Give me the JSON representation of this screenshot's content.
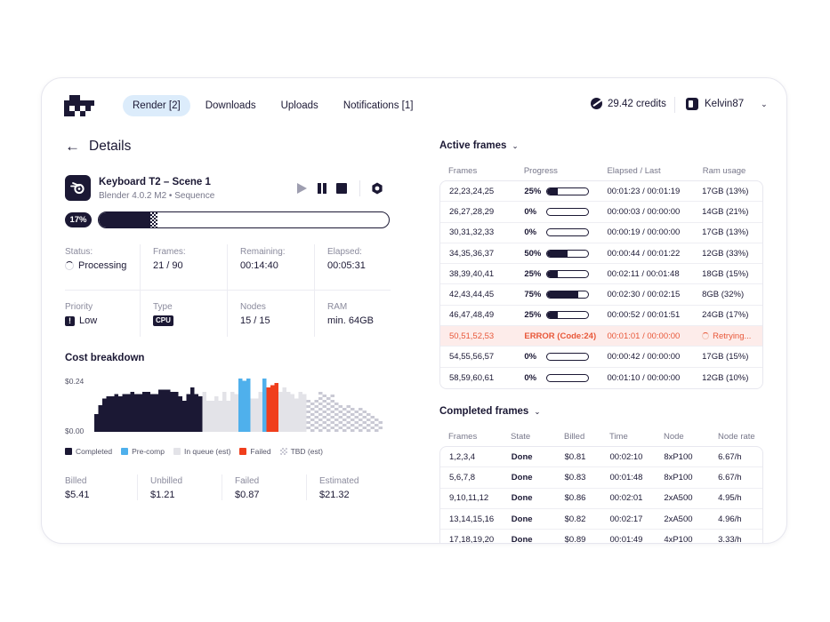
{
  "nav": {
    "tabs": [
      {
        "label": "Render [2]",
        "active": true
      },
      {
        "label": "Downloads",
        "active": false
      },
      {
        "label": "Uploads",
        "active": false
      },
      {
        "label": "Notifications [1]",
        "active": false
      }
    ],
    "credits": "29.42 credits",
    "user": "Kelvin87"
  },
  "details": {
    "title": "Details",
    "job_name": "Keyboard T2 – Scene 1",
    "job_sub": "Blender 4.0.2 M2 • Sequence",
    "progress_label": "17%",
    "progress_value": 0.17,
    "stats": [
      {
        "label": "Status:",
        "value": "Processing"
      },
      {
        "label": "Frames:",
        "value": "21 / 90"
      },
      {
        "label": "Remaining:",
        "value": "00:14:40"
      },
      {
        "label": "Elapsed:",
        "value": "00:05:31"
      },
      {
        "label": "Priority",
        "value": "Low"
      },
      {
        "label": "Type",
        "value": "CPU"
      },
      {
        "label": "Nodes",
        "value": "15 / 15"
      },
      {
        "label": "RAM",
        "value": "min. 64GB"
      }
    ]
  },
  "cost": {
    "title": "Cost breakdown",
    "y_top": "$0.24",
    "y_bottom": "$0.00",
    "legend": [
      {
        "label": "Completed",
        "color": "#1b1834"
      },
      {
        "label": "Pre-comp",
        "color": "#4fb0ec"
      },
      {
        "label": "In queue (est)",
        "color": "#e3e3e8"
      },
      {
        "label": "Failed",
        "color": "#f03e1c"
      },
      {
        "label": "TBD (est)",
        "color": "#c9c9d4"
      }
    ],
    "billing": [
      {
        "label": "Billed",
        "value": "$5.41"
      },
      {
        "label": "Unbilled",
        "value": "$1.21"
      },
      {
        "label": "Failed",
        "value": "$0.87"
      },
      {
        "label": "Estimated",
        "value": "$21.32"
      }
    ]
  },
  "chart_data": {
    "type": "bar",
    "ylim": [
      0,
      0.24
    ],
    "values": [
      0.08,
      0.12,
      0.15,
      0.16,
      0.16,
      0.17,
      0.16,
      0.17,
      0.17,
      0.18,
      0.17,
      0.17,
      0.18,
      0.18,
      0.17,
      0.17,
      0.19,
      0.19,
      0.19,
      0.18,
      0.18,
      0.16,
      0.14,
      0.17,
      0.2,
      0.17,
      0.16,
      0.18,
      0.14,
      0.14,
      0.16,
      0.14,
      0.18,
      0.14,
      0.18,
      0.17,
      0.24,
      0.23,
      0.27,
      0.15,
      0.15,
      0.18,
      0.27,
      0.2,
      0.21,
      0.22,
      0.18,
      0.2,
      0.18,
      0.17,
      0.15,
      0.18,
      0.17,
      0.16,
      0.14,
      0.16,
      0.18,
      0.17,
      0.15,
      0.17,
      0.14,
      0.13,
      0.12,
      0.12,
      0.11,
      0.1,
      0.12,
      0.1,
      0.09,
      0.08,
      0.07,
      0.06
    ],
    "kinds": [
      "c",
      "c",
      "c",
      "c",
      "c",
      "c",
      "c",
      "c",
      "c",
      "c",
      "c",
      "c",
      "c",
      "c",
      "c",
      "c",
      "c",
      "c",
      "c",
      "c",
      "c",
      "c",
      "c",
      "c",
      "c",
      "c",
      "c",
      "q",
      "q",
      "q",
      "q",
      "q",
      "q",
      "q",
      "q",
      "q",
      "p",
      "p",
      "p",
      "q",
      "q",
      "q",
      "p",
      "f",
      "f",
      "f",
      "q",
      "q",
      "q",
      "q",
      "q",
      "q",
      "q",
      "t",
      "t",
      "t",
      "t",
      "t",
      "t",
      "t",
      "t",
      "t",
      "t",
      "t",
      "t",
      "t",
      "t",
      "t",
      "t",
      "t",
      "t",
      "t"
    ]
  },
  "active_frames": {
    "title": "Active frames",
    "columns": [
      "Frames",
      "Progress",
      "Elapsed / Last",
      "Ram usage"
    ],
    "rows": [
      {
        "frames": "22,23,24,25",
        "progress": "25%",
        "p": 0.25,
        "elapsed": "00:01:23 / 00:01:19",
        "ram": "17GB (13%)",
        "error": false
      },
      {
        "frames": "26,27,28,29",
        "progress": "0%",
        "p": 0,
        "elapsed": "00:00:03 / 00:00:00",
        "ram": "14GB (21%)",
        "error": false
      },
      {
        "frames": "30,31,32,33",
        "progress": "0%",
        "p": 0,
        "elapsed": "00:00:19 / 00:00:00",
        "ram": "17GB (13%)",
        "error": false
      },
      {
        "frames": "34,35,36,37",
        "progress": "50%",
        "p": 0.5,
        "elapsed": "00:00:44 / 00:01:22",
        "ram": "12GB (33%)",
        "error": false
      },
      {
        "frames": "38,39,40,41",
        "progress": "25%",
        "p": 0.25,
        "elapsed": "00:02:11 / 00:01:48",
        "ram": "18GB (15%)",
        "error": false
      },
      {
        "frames": "42,43,44,45",
        "progress": "75%",
        "p": 0.75,
        "elapsed": "00:02:30 / 00:02:15",
        "ram": "8GB (32%)",
        "error": false
      },
      {
        "frames": "46,47,48,49",
        "progress": "25%",
        "p": 0.25,
        "elapsed": "00:00:52 / 00:01:51",
        "ram": "24GB (17%)",
        "error": false
      },
      {
        "frames": "50,51,52,53",
        "progress": "ERROR (Code:24)",
        "p": 0,
        "elapsed": "00:01:01 / 00:00:00",
        "ram": "Retrying...",
        "error": true
      },
      {
        "frames": "54,55,56,57",
        "progress": "0%",
        "p": 0,
        "elapsed": "00:00:42 / 00:00:00",
        "ram": "17GB (15%)",
        "error": false
      },
      {
        "frames": "58,59,60,61",
        "progress": "0%",
        "p": 0,
        "elapsed": "00:01:10 / 00:00:00",
        "ram": "12GB (10%)",
        "error": false
      }
    ]
  },
  "completed_frames": {
    "title": "Completed frames",
    "columns": [
      "Frames",
      "State",
      "Billed",
      "Time",
      "Node",
      "Node rate"
    ],
    "rows": [
      {
        "frames": "1,2,3,4",
        "state": "Done",
        "billed": "$0.81",
        "time": "00:02:10",
        "node": "8xP100",
        "rate": "6.67/h"
      },
      {
        "frames": "5,6,7,8",
        "state": "Done",
        "billed": "$0.83",
        "time": "00:01:48",
        "node": "8xP100",
        "rate": "6.67/h"
      },
      {
        "frames": "9,10,11,12",
        "state": "Done",
        "billed": "$0.86",
        "time": "00:02:01",
        "node": "2xA500",
        "rate": "4.95/h"
      },
      {
        "frames": "13,14,15,16",
        "state": "Done",
        "billed": "$0.82",
        "time": "00:02:17",
        "node": "2xA500",
        "rate": "4.96/h"
      },
      {
        "frames": "17,18,19,20",
        "state": "Done",
        "billed": "$0.89",
        "time": "00:01:49",
        "node": "4xP100",
        "rate": "3.33/h"
      }
    ]
  }
}
